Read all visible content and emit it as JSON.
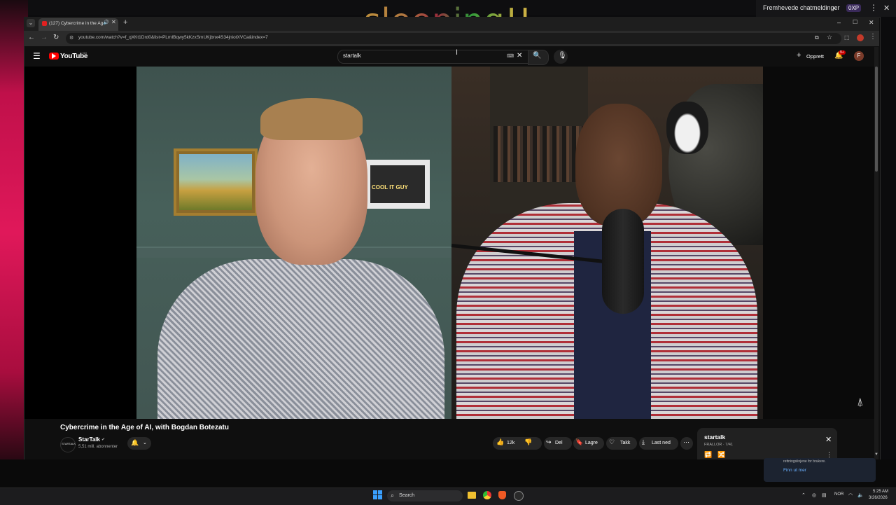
{
  "overlay": {
    "title": "sleeping!!"
  },
  "chat_widget": {
    "label": "Fremhevede chatmeldinger",
    "xp_badge": "0XP"
  },
  "browser": {
    "tab_title": "(127) Cybercrime in the Ag",
    "url": "youtube.com/watch?v=f_qXKt1Drd0&list=PLmIBqwy5kKzxSmUKjbnx4S34jniotXVCa&index=7",
    "profile_initial": "F"
  },
  "youtube": {
    "logo_text": "YouTube",
    "logo_region": "NO",
    "search_value": "startalk",
    "create_label": "Opprett",
    "notification_count": "9+",
    "avatar_initial": "F"
  },
  "video": {
    "title": "Cybercrime in the Age of AI, with Bogdan Botezatu",
    "sign_text": "COOL IT GUY",
    "channel": {
      "name": "StarTalk",
      "avatar_text": "STARTALK",
      "subscribers": "5,51 mill. abonnenter"
    },
    "actions": {
      "likes": "12k",
      "share": "Del",
      "save": "Lagre",
      "thanks": "Takk",
      "download": "Last ned"
    }
  },
  "playlist": {
    "title": "startalk",
    "subtitle": "FRALLOR · 7/41"
  },
  "notification": {
    "text": "rettningslinjene for brukere.",
    "link": "Finn ut mer"
  },
  "taskbar": {
    "search_placeholder": "Search",
    "lang": "NOR",
    "time": "5:25 AM",
    "date": "3/26/2026"
  },
  "colors": {
    "yt_red": "#ff0000",
    "accent_blue": "#3aa0ff",
    "bg": "#0f0f0f"
  }
}
